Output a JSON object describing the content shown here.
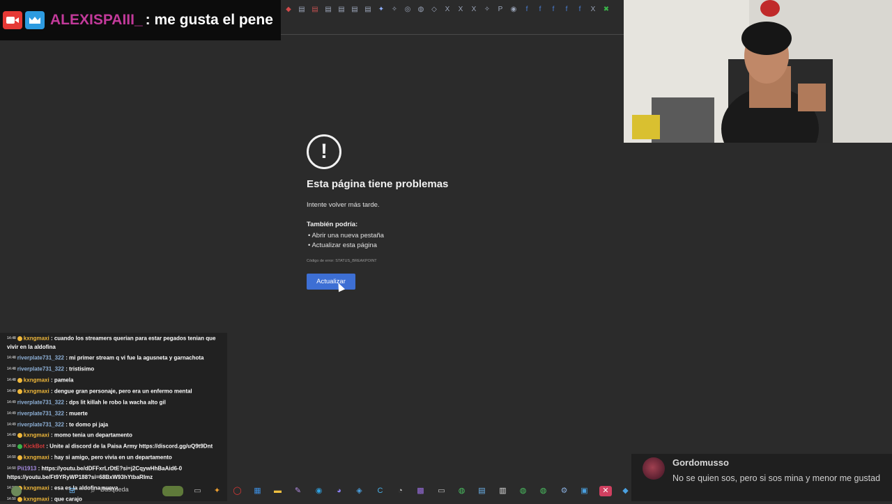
{
  "alert": {
    "user": "ALEXISPAIII_",
    "message": ": me gusta el pene"
  },
  "error_page": {
    "title": "Esta página tiene problemas",
    "subtitle": "Intente volver más tarde.",
    "also_heading": "También podría:",
    "suggestions": [
      "Abrir una nueva pestaña",
      "Actualizar esta página"
    ],
    "error_code": "Código de error: STATUS_BREAKPOINT",
    "reload_label": "Actualizar"
  },
  "chat": {
    "messages": [
      {
        "time": "14:48",
        "user": "kxngmaxi",
        "text": ": cuando los streamers querian para estar pegados tenian que vivir en la aldofina"
      },
      {
        "time": "14:48",
        "user": "riverplate731_322",
        "text": ": mi primer stream q vi fue la agusneta y garnachota"
      },
      {
        "time": "14:48",
        "user": "riverplate731_322",
        "text": ": tristisimo"
      },
      {
        "time": "14:48",
        "user": "kxngmaxi",
        "text": ": pamela"
      },
      {
        "time": "14:49",
        "user": "kxngmaxi",
        "text": ": dengue gran personaje, pero era un enfermo mental"
      },
      {
        "time": "14:49",
        "user": "riverplate731_322",
        "text": ": dps lit killah le robo la wacha alto gil"
      },
      {
        "time": "14:49",
        "user": "riverplate731_322",
        "text": ": muerte"
      },
      {
        "time": "14:49",
        "user": "riverplate731_322",
        "text": ": te domo pi jaja"
      },
      {
        "time": "14:49",
        "user": "kxngmaxi",
        "text": ": momo tenia un departamento"
      },
      {
        "time": "14:50",
        "user": "KickBot",
        "text": ": Unite al discord de la Paisa Army https://discord.gg/uQ9t9Dnt"
      },
      {
        "time": "14:50",
        "user": "kxngmaxi",
        "text": ": hay si amigo, pero vivia en un departamento"
      },
      {
        "time": "14:50",
        "user": "Pii1913",
        "text": ": https://youtu.be/dDFFxrLrDtE?si=j2CqywHhBaAid6-0 https://youtu.be/Ft9YRyWP188?si=68BxW93hYtbaRImz"
      },
      {
        "time": "14:50",
        "user": "kxngmaxi",
        "text": ": esa es la aldofina nueva"
      },
      {
        "time": "14:50",
        "user": "kxngmaxi",
        "text": ": que carajo"
      }
    ]
  },
  "donation": {
    "name": "Gordomusso",
    "message": "No se quien sos, pero si sos mina y menor me gustad"
  },
  "taskbar": {
    "search_label": "Búsqueda"
  },
  "colors": {
    "page_bg": "#2b2b2b",
    "button": "#3d6fd4",
    "user_kx": "#f0b83a",
    "user_rv": "#8fb2d9",
    "kickbot": "#d83a3a",
    "alert_user": "#c23a9a"
  }
}
